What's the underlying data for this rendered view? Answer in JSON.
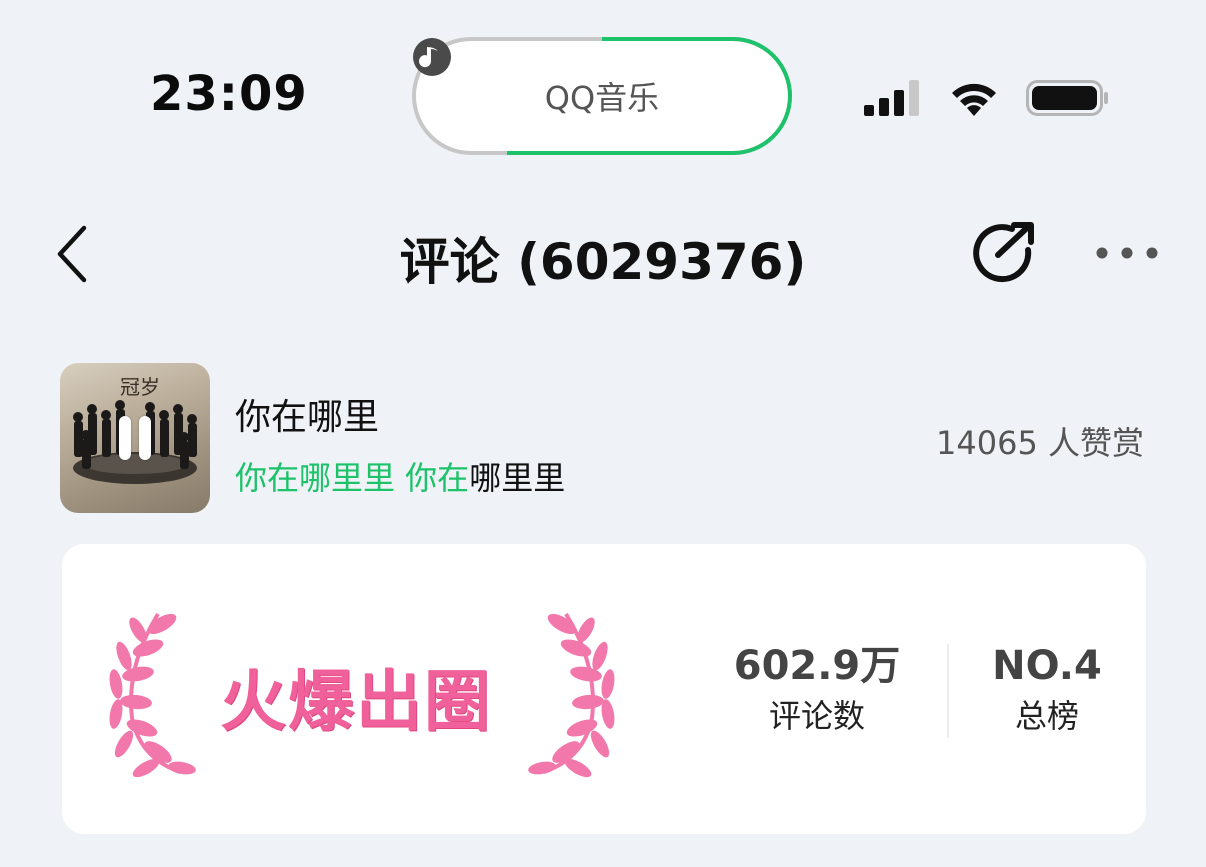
{
  "status_bar": {
    "time": "23:09",
    "island_app": "QQ音乐",
    "icons": [
      "signal-icon",
      "wifi-icon",
      "battery-icon"
    ]
  },
  "nav": {
    "title": "评论 (6029376)",
    "icons": [
      "back-chevron-icon",
      "share-icon",
      "more-icon"
    ]
  },
  "song": {
    "cover_title": "冠岁",
    "name": "你在哪里",
    "lyric_sung": "你在哪里里 你在",
    "lyric_rest": "哪里里",
    "rewards": "14065 人赞赏"
  },
  "hot_card": {
    "badge_text": "火爆出圈",
    "comments_value": "602.9万",
    "comments_label": "评论数",
    "rank_value": "NO.4",
    "rank_label": "总榜"
  },
  "colors": {
    "accent_green": "#1ec26a",
    "badge_pink": "#f0609b",
    "background": "#eff3f7"
  }
}
